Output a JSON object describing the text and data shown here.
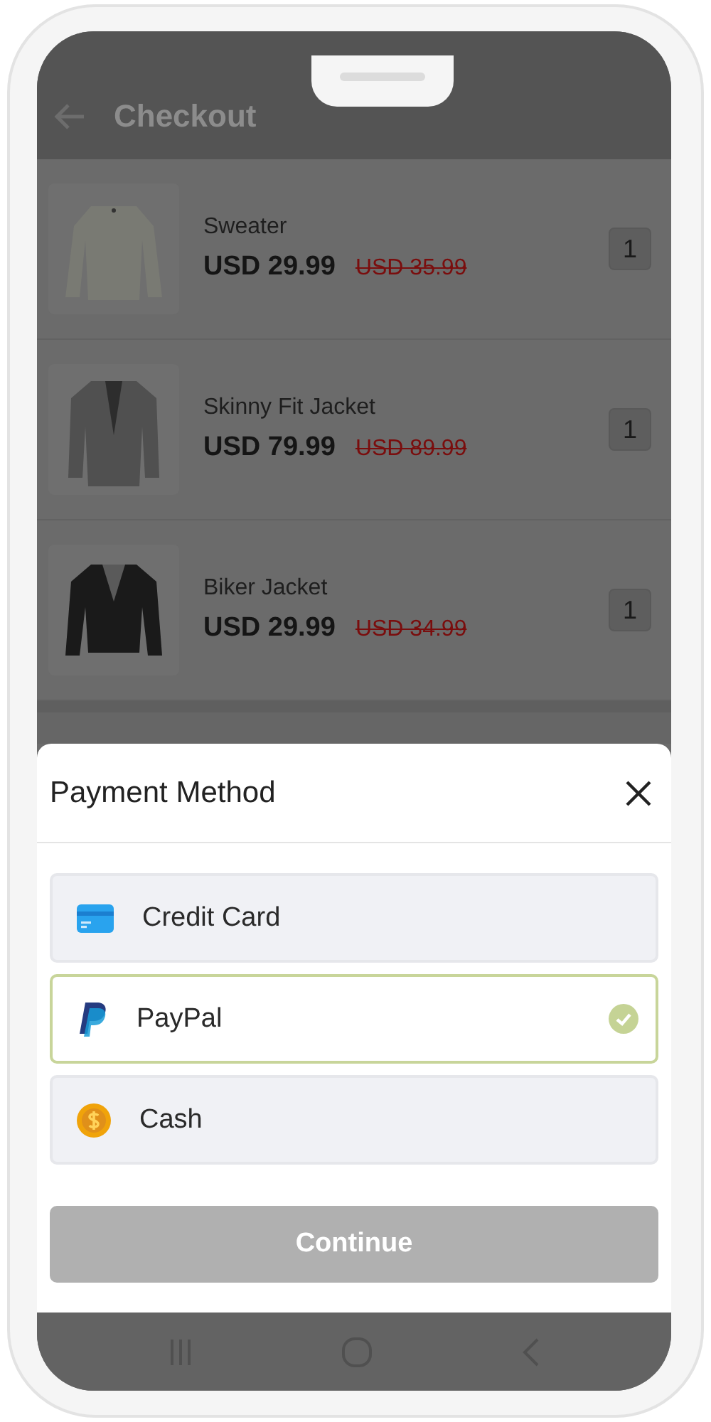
{
  "header": {
    "title": "Checkout"
  },
  "items": [
    {
      "name": "Sweater",
      "price": "USD 29.99",
      "old_price": "USD 35.99",
      "quantity": "1",
      "kind": "sweater"
    },
    {
      "name": "Skinny Fit Jacket",
      "price": "USD 79.99",
      "old_price": "USD 89.99",
      "quantity": "1",
      "kind": "blazer"
    },
    {
      "name": "Biker Jacket",
      "price": "USD 29.99",
      "old_price": "USD 34.99",
      "quantity": "1",
      "kind": "leather"
    }
  ],
  "sheet": {
    "title": "Payment Method",
    "options": [
      {
        "label": "Credit Card",
        "kind": "card",
        "selected": false
      },
      {
        "label": "PayPal",
        "kind": "paypal",
        "selected": true
      },
      {
        "label": "Cash",
        "kind": "cash",
        "selected": false
      }
    ],
    "button": {
      "label": "Continue",
      "disabled": true
    }
  }
}
